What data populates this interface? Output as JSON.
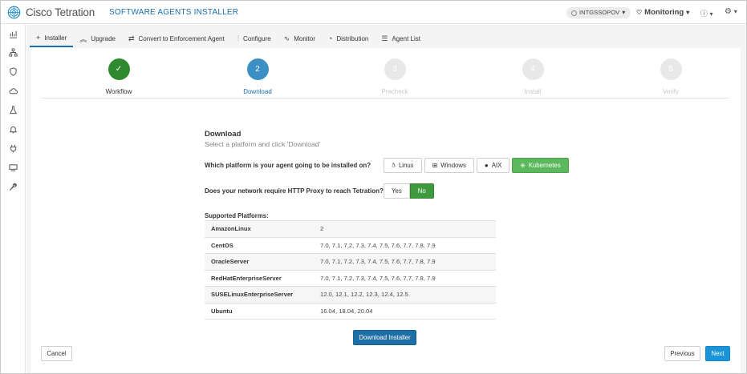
{
  "header": {
    "brand": "Cisco Tetration",
    "page_title": "SOFTWARE AGENTS INSTALLER",
    "tenant": "INTGSSOPOV",
    "monitoring_label": "Monitoring",
    "help_icon": "question-circle-icon",
    "settings_icon": "gear-icon"
  },
  "sidebar": {
    "icons": [
      "dashboard-icon",
      "topology-icon",
      "shield-icon",
      "cloud-icon",
      "flask-icon",
      "bell-icon",
      "plug-icon",
      "server-icon",
      "wrench-icon"
    ]
  },
  "tabs": [
    {
      "label": "Installer",
      "icon": "plus-icon",
      "active": true
    },
    {
      "label": "Upgrade",
      "icon": "double-chevron-up-icon"
    },
    {
      "label": "Convert to Enforcement Agent",
      "icon": "arrows-exchange-icon"
    },
    {
      "label": "Configure",
      "icon": "sliders-icon"
    },
    {
      "label": "Monitor",
      "icon": "pulse-icon"
    },
    {
      "label": "Distribution",
      "icon": "pie-chart-icon"
    },
    {
      "label": "Agent List",
      "icon": "list-icon"
    }
  ],
  "steps": [
    {
      "number": "✓",
      "label": "Workflow",
      "state": "done"
    },
    {
      "number": "2",
      "label": "Download",
      "state": "current"
    },
    {
      "number": "3",
      "label": "Precheck",
      "state": "future"
    },
    {
      "number": "4",
      "label": "Install",
      "state": "future"
    },
    {
      "number": "5",
      "label": "Verify",
      "state": "future"
    }
  ],
  "download": {
    "title": "Download",
    "subtitle": "Select a platform and click 'Download'",
    "platform_question": "Which platform is your agent going to be installed on?",
    "platforms": [
      {
        "label": "Linux",
        "icon": "linux-icon",
        "selected": false
      },
      {
        "label": "Windows",
        "icon": "windows-icon",
        "selected": false
      },
      {
        "label": "AIX",
        "icon": "aix-icon",
        "selected": false
      },
      {
        "label": "Kubernetes",
        "icon": "kubernetes-icon",
        "selected": true
      }
    ],
    "proxy_question": "Does your network require HTTP Proxy to reach Tetration?",
    "proxy_options": [
      {
        "label": "Yes",
        "selected": false
      },
      {
        "label": "No",
        "selected": true
      }
    ],
    "supported_label": "Supported Platforms:",
    "supported": [
      {
        "name": "AmazonLinux",
        "versions": "2"
      },
      {
        "name": "CentOS",
        "versions": "7.0, 7.1, 7.2, 7.3, 7.4, 7.5, 7.6, 7.7, 7.8, 7.9"
      },
      {
        "name": "OracleServer",
        "versions": "7.0, 7.1, 7.2, 7.3, 7.4, 7.5, 7.6, 7.7, 7.8, 7.9"
      },
      {
        "name": "RedHatEnterpriseServer",
        "versions": "7.0, 7.1, 7.2, 7.3, 7.4, 7.5, 7.6, 7.7, 7.8, 7.9"
      },
      {
        "name": "SUSELinuxEnterpriseServer",
        "versions": "12.0, 12.1, 12.2, 12.3, 12.4, 12.5"
      },
      {
        "name": "Ubuntu",
        "versions": "16.04, 18.04, 20.04"
      }
    ],
    "download_button": "Download Installer"
  },
  "footer": {
    "cancel": "Cancel",
    "previous": "Previous",
    "next": "Next"
  },
  "colors": {
    "accent": "#1a6fb0",
    "success": "#2f8a2f",
    "selected_platform": "#5cb85c",
    "next_button": "#1a94d8"
  }
}
